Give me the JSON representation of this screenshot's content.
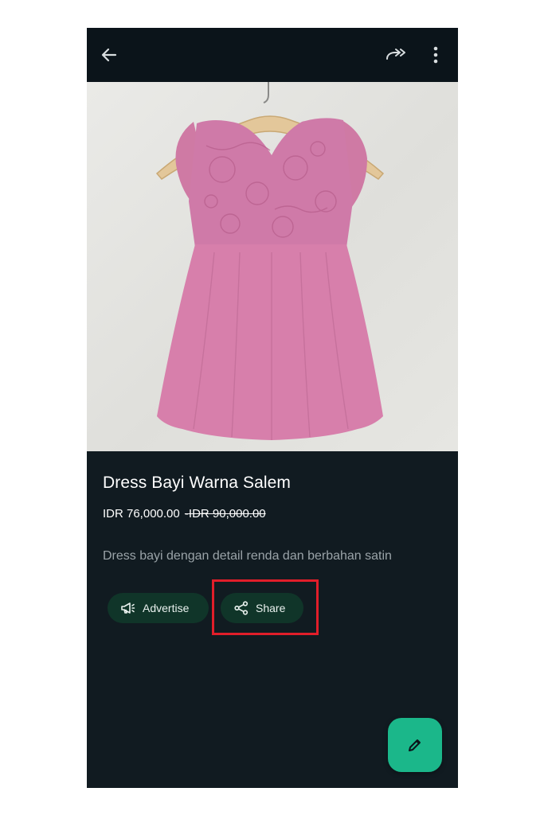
{
  "topbar": {
    "back_icon": "arrow-left-icon",
    "forward_icon": "forward-icon",
    "more_icon": "more-vertical-icon"
  },
  "product": {
    "image_icon": "product-photo",
    "title": "Dress Bayi Warna Salem",
    "price": "IDR 76,000.00",
    "original_price": "IDR 90,000.00",
    "description": "Dress bayi dengan detail renda dan berbahan satin"
  },
  "actions": {
    "advertise_label": "Advertise",
    "advertise_icon": "megaphone-icon",
    "share_label": "Share",
    "share_icon": "share-icon"
  },
  "fab": {
    "icon": "pencil-icon"
  },
  "colors": {
    "background": "#111b21",
    "topbar": "#0b141a",
    "chip": "#103529",
    "fab": "#1bb78a",
    "highlight": "#e11e2a"
  }
}
